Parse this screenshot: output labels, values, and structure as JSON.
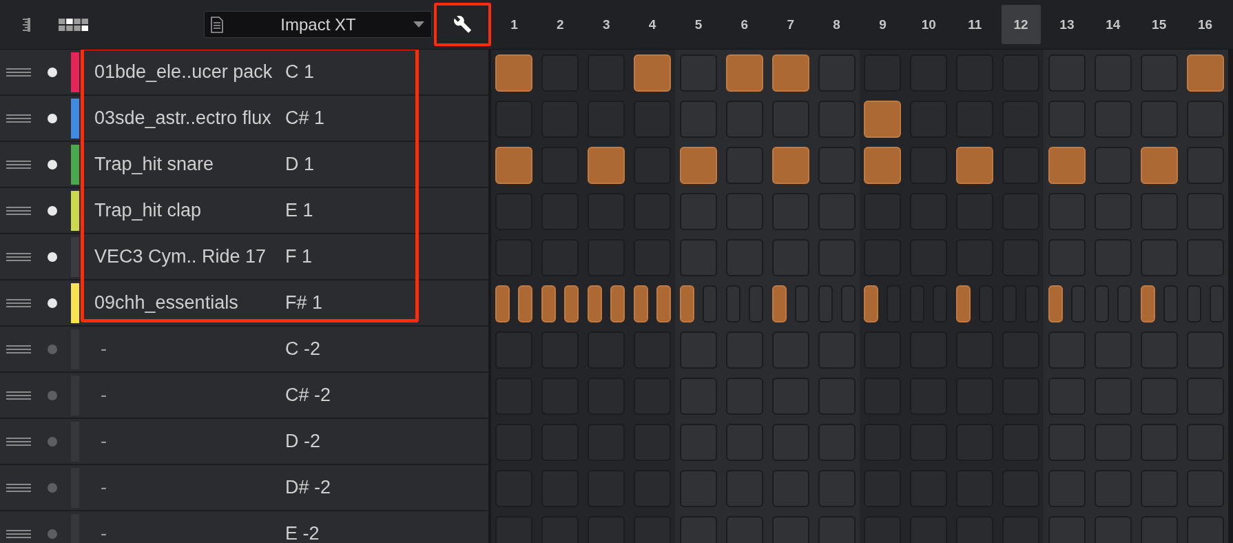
{
  "toolbar": {
    "instrument": "Impact XT",
    "tool_button": {
      "highlighted": true
    }
  },
  "steps": [
    {
      "label": "1",
      "current": false
    },
    {
      "label": "2",
      "current": false
    },
    {
      "label": "3",
      "current": false
    },
    {
      "label": "4",
      "current": false
    },
    {
      "label": "5",
      "current": false
    },
    {
      "label": "6",
      "current": false
    },
    {
      "label": "7",
      "current": false
    },
    {
      "label": "8",
      "current": false
    },
    {
      "label": "9",
      "current": false
    },
    {
      "label": "10",
      "current": false
    },
    {
      "label": "11",
      "current": false
    },
    {
      "label": "12",
      "current": true
    },
    {
      "label": "13",
      "current": false
    },
    {
      "label": "14",
      "current": false
    },
    {
      "label": "15",
      "current": false
    },
    {
      "label": "16",
      "current": false
    }
  ],
  "pads": [
    {
      "name": "01bde_ele..ucer pack",
      "note": "C 1",
      "color": "#e6245a",
      "active": true,
      "highlighted": true,
      "steps": [
        true,
        false,
        false,
        true,
        false,
        true,
        true,
        false,
        false,
        false,
        false,
        false,
        false,
        false,
        false,
        true
      ]
    },
    {
      "name": "03sde_astr..ectro flux",
      "note": "C# 1",
      "color": "#3d8be2",
      "active": true,
      "highlighted": true,
      "steps": [
        false,
        false,
        false,
        false,
        false,
        false,
        false,
        false,
        true,
        false,
        false,
        false,
        false,
        false,
        false,
        false
      ]
    },
    {
      "name": "Trap_hit snare",
      "note": "D 1",
      "color": "#4aa94c",
      "active": true,
      "highlighted": true,
      "steps": [
        true,
        false,
        true,
        false,
        true,
        false,
        true,
        false,
        true,
        false,
        true,
        false,
        true,
        false,
        true,
        false
      ]
    },
    {
      "name": "Trap_hit clap",
      "note": "E 1",
      "color": "#ccd94c",
      "active": true,
      "highlighted": true,
      "steps": [
        false,
        false,
        false,
        false,
        false,
        false,
        false,
        false,
        false,
        false,
        false,
        false,
        false,
        false,
        false,
        false
      ]
    },
    {
      "name": "VEC3 Cym.. Ride 17",
      "note": "F 1",
      "color": "#3b3c41",
      "active": true,
      "highlighted": true,
      "steps": [
        false,
        false,
        false,
        false,
        false,
        false,
        false,
        false,
        false,
        false,
        false,
        false,
        false,
        false,
        false,
        false
      ]
    },
    {
      "name": "09chh_essentials",
      "note": "F# 1",
      "color": "#f7e350",
      "active": true,
      "highlighted": true,
      "steps": [
        true,
        true,
        true,
        true,
        true,
        true,
        true,
        true,
        true,
        false,
        false,
        false,
        true,
        false,
        false,
        false,
        true,
        false,
        false,
        false,
        true,
        false,
        false,
        false,
        true,
        false,
        false,
        false,
        true,
        false,
        false,
        false
      ]
    },
    {
      "name": "-",
      "note": "C -2",
      "color": "#36373b",
      "active": false,
      "highlighted": false,
      "steps": [
        false,
        false,
        false,
        false,
        false,
        false,
        false,
        false,
        false,
        false,
        false,
        false,
        false,
        false,
        false,
        false
      ]
    },
    {
      "name": "-",
      "note": "C# -2",
      "color": "#36373b",
      "active": false,
      "highlighted": false,
      "steps": [
        false,
        false,
        false,
        false,
        false,
        false,
        false,
        false,
        false,
        false,
        false,
        false,
        false,
        false,
        false,
        false
      ]
    },
    {
      "name": "-",
      "note": "D -2",
      "color": "#36373b",
      "active": false,
      "highlighted": false,
      "steps": [
        false,
        false,
        false,
        false,
        false,
        false,
        false,
        false,
        false,
        false,
        false,
        false,
        false,
        false,
        false,
        false
      ]
    },
    {
      "name": "-",
      "note": "D# -2",
      "color": "#36373b",
      "active": false,
      "highlighted": false,
      "steps": [
        false,
        false,
        false,
        false,
        false,
        false,
        false,
        false,
        false,
        false,
        false,
        false,
        false,
        false,
        false,
        false
      ]
    },
    {
      "name": "-",
      "note": "E -2",
      "color": "#36373b",
      "active": false,
      "highlighted": false,
      "steps": [
        false,
        false,
        false,
        false,
        false,
        false,
        false,
        false,
        false,
        false,
        false,
        false,
        false,
        false,
        false,
        false
      ]
    }
  ]
}
